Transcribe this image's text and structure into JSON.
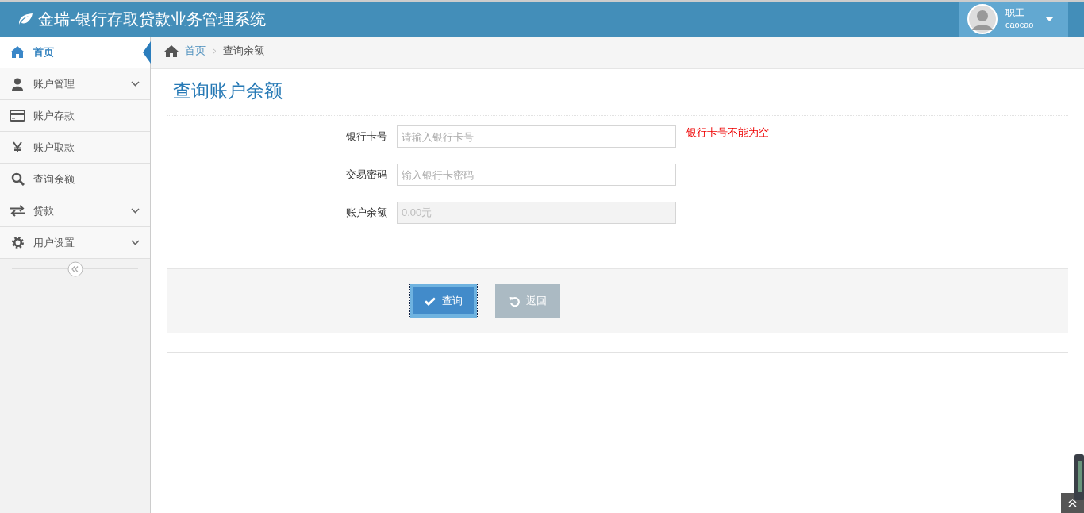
{
  "header": {
    "title": "金瑞-银行存取贷款业务管理系统",
    "user": {
      "role": "职工",
      "name": "caocao"
    }
  },
  "sidebar": {
    "items": [
      {
        "label": "首页",
        "selected": true,
        "expandable": false
      },
      {
        "label": "账户管理",
        "selected": false,
        "expandable": true
      },
      {
        "label": "账户存款",
        "selected": false,
        "expandable": false
      },
      {
        "label": "账户取款",
        "selected": false,
        "expandable": false
      },
      {
        "label": "查询余额",
        "selected": false,
        "expandable": false
      },
      {
        "label": "贷款",
        "selected": false,
        "expandable": true
      },
      {
        "label": "用户设置",
        "selected": false,
        "expandable": true
      }
    ]
  },
  "breadcrumb": [
    "首页",
    "查询余额"
  ],
  "page_title": "查询账户余额",
  "form": {
    "fields": [
      {
        "label": "银行卡号",
        "placeholder": "请输入银行卡号",
        "disabled": false,
        "error": "银行卡号不能为空"
      },
      {
        "label": "交易密码",
        "placeholder": "输入银行卡密码",
        "disabled": false
      },
      {
        "label": "账户余额",
        "value": "0.00元",
        "disabled": true
      }
    ],
    "buttons": [
      {
        "label": "查询",
        "kind": "primary"
      },
      {
        "label": "返回",
        "kind": "back"
      }
    ]
  }
}
